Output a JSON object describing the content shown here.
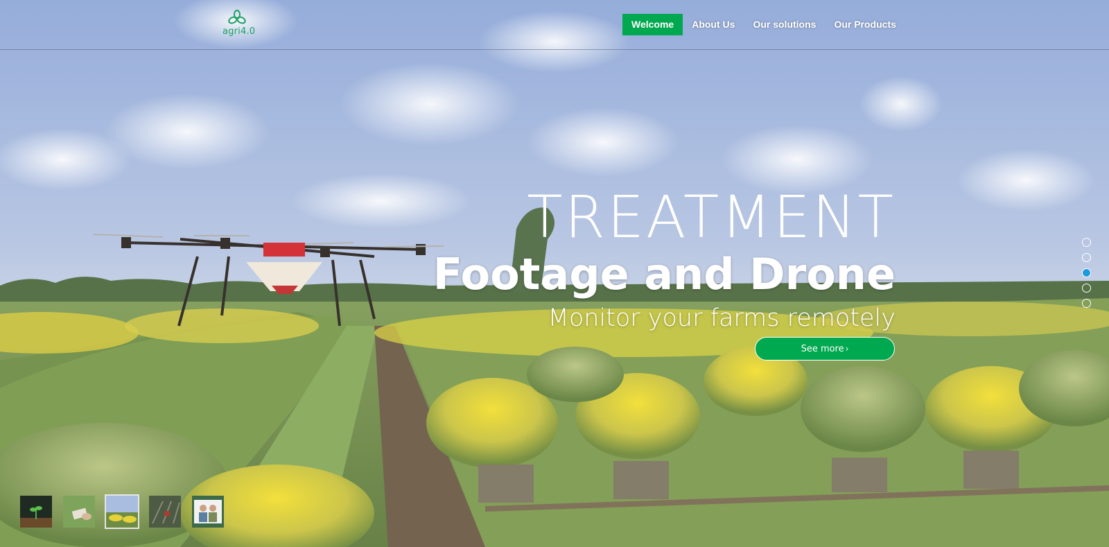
{
  "brand": {
    "logo_text": "agri4.0",
    "color": "#1aa060"
  },
  "nav": {
    "items": [
      {
        "label": "Welcome",
        "active": true
      },
      {
        "label": "About Us",
        "active": false
      },
      {
        "label": "Our solutions",
        "active": false
      },
      {
        "label": "Our Products",
        "active": false
      }
    ],
    "active_color": "#00a84f"
  },
  "hero": {
    "title_line1": "TREATMENT",
    "title_line2": "Footage and Drone",
    "subtitle": "Monitor your farms remotely",
    "cta_label": "See more",
    "cta_icon": "chevron-right-icon",
    "cta_color": "#00a84f"
  },
  "slider": {
    "total_slides": 5,
    "active_index": 2,
    "active_dot_color": "#1e9bdc",
    "thumbnails": [
      {
        "name": "seedling-thumbnail",
        "active": false
      },
      {
        "name": "field-hand-thumbnail",
        "active": false
      },
      {
        "name": "flower-field-thumbnail",
        "active": true
      },
      {
        "name": "vineyard-thumbnail",
        "active": false
      },
      {
        "name": "farmers-thumbnail",
        "active": false
      }
    ]
  }
}
